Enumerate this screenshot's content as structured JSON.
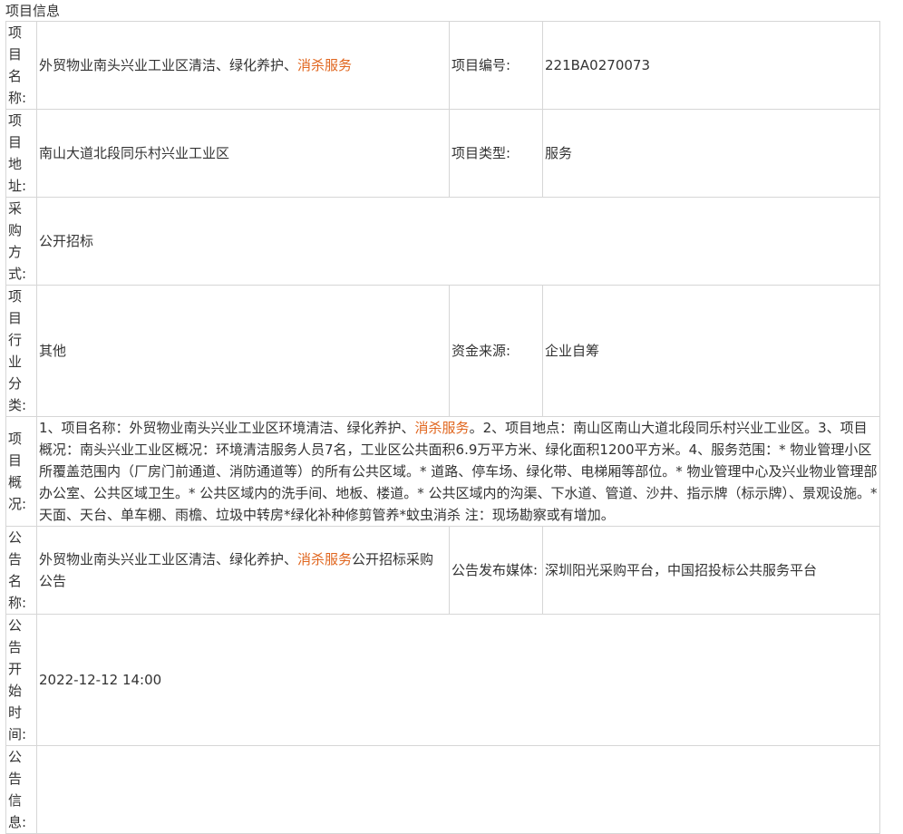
{
  "section_title": "项目信息",
  "rows": {
    "project_name": {
      "label": "项目名称:",
      "value_a": "外贸物业南头兴业工业区清洁、绿化养护、",
      "value_hl": "消杀服务",
      "label2": "项目编号:",
      "value2": "221BA0270073"
    },
    "project_address": {
      "label": "项目地址:",
      "value": "南山大道北段同乐村兴业工业区",
      "label2": "项目类型:",
      "value2": "服务"
    },
    "procurement_method": {
      "label": "采购方式:",
      "value": "公开招标"
    },
    "industry": {
      "label": "项目行业分类:",
      "value": "其他",
      "label2": "资金来源:",
      "value2": "企业自筹"
    },
    "overview": {
      "label": "项目概况:",
      "text_a": "1、项目名称：外贸物业南头兴业工业区环境清洁、绿化养护、",
      "text_hl": "消杀服务",
      "text_b": "。2、项目地点：南山区南山大道北段同乐村兴业工业区。3、项目概况：南头兴业工业区概况：环境清洁服务人员7名，工业区公共面积6.9万平方米、绿化面积1200平方米。4、服务范围：* 物业管理小区所覆盖范围内（厂房门前通道、消防通道等）的所有公共区域。* 道路、停车场、绿化带、电梯厢等部位。* 物业管理中心及兴业物业管理部办公室、公共区域卫生。* 公共区域内的洗手间、地板、楼道。* 公共区域内的沟渠、下水道、管道、沙井、指示牌（标示牌）、景观设施。* 天面、天台、单车棚、雨檐、垃圾中转房*绿化补种修剪管养*蚊虫消杀 注：现场勘察或有增加。"
    },
    "announcement_name": {
      "label": "公告名称:",
      "value_a": "外贸物业南头兴业工业区清洁、绿化养护、",
      "value_hl": "消杀服务",
      "value_b": "公开招标采购公告",
      "label2": "公告发布媒体:",
      "value2": "深圳阳光采购平台，中国招投标公共服务平台"
    },
    "start_time": {
      "label": "公告开始时间:",
      "value": "2022-12-12 14:00"
    },
    "announcement_info": {
      "label": "公告信息:",
      "value": ""
    }
  },
  "colors": {
    "highlight": "#e0651d",
    "border": "#d6d6d6",
    "text": "#333333"
  }
}
